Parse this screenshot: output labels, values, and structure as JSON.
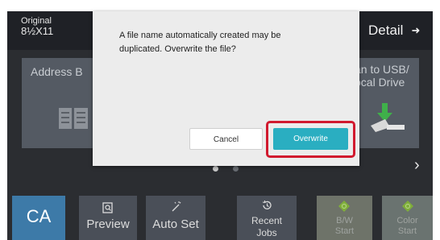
{
  "header": {
    "original_label": "Original",
    "paper_size": "8½X11",
    "detail_label": "Detail"
  },
  "tiles": {
    "address_book_label": "Address B",
    "usb_line1": "an to USB/",
    "usb_line2": "ocal Drive"
  },
  "dialog": {
    "message_line1": "A file name automatically created may be",
    "message_line2": "duplicated. Overwrite the file?",
    "cancel_label": "Cancel",
    "overwrite_label": "Overwrite"
  },
  "bottom_bar": {
    "ca_label": "CA",
    "preview_label": "Preview",
    "autoset_label": "Auto Set",
    "recent_line1": "Recent",
    "recent_line2": "Jobs",
    "bw_line1": "B/W",
    "bw_line2": "Start",
    "color_line1": "Color",
    "color_line2": "Start"
  },
  "icons": [
    "arrow-right-icon",
    "address-book-icon",
    "usb-drive-icon",
    "chevron-right-icon",
    "preview-icon",
    "auto-set-icon",
    "history-icon",
    "start-diamond-icon"
  ],
  "colors": {
    "overwrite_button": "#2aaec1",
    "highlight_border": "#d11a2f",
    "ca_button": "#3d7aa8",
    "screen_bg": "#2b2d31"
  }
}
